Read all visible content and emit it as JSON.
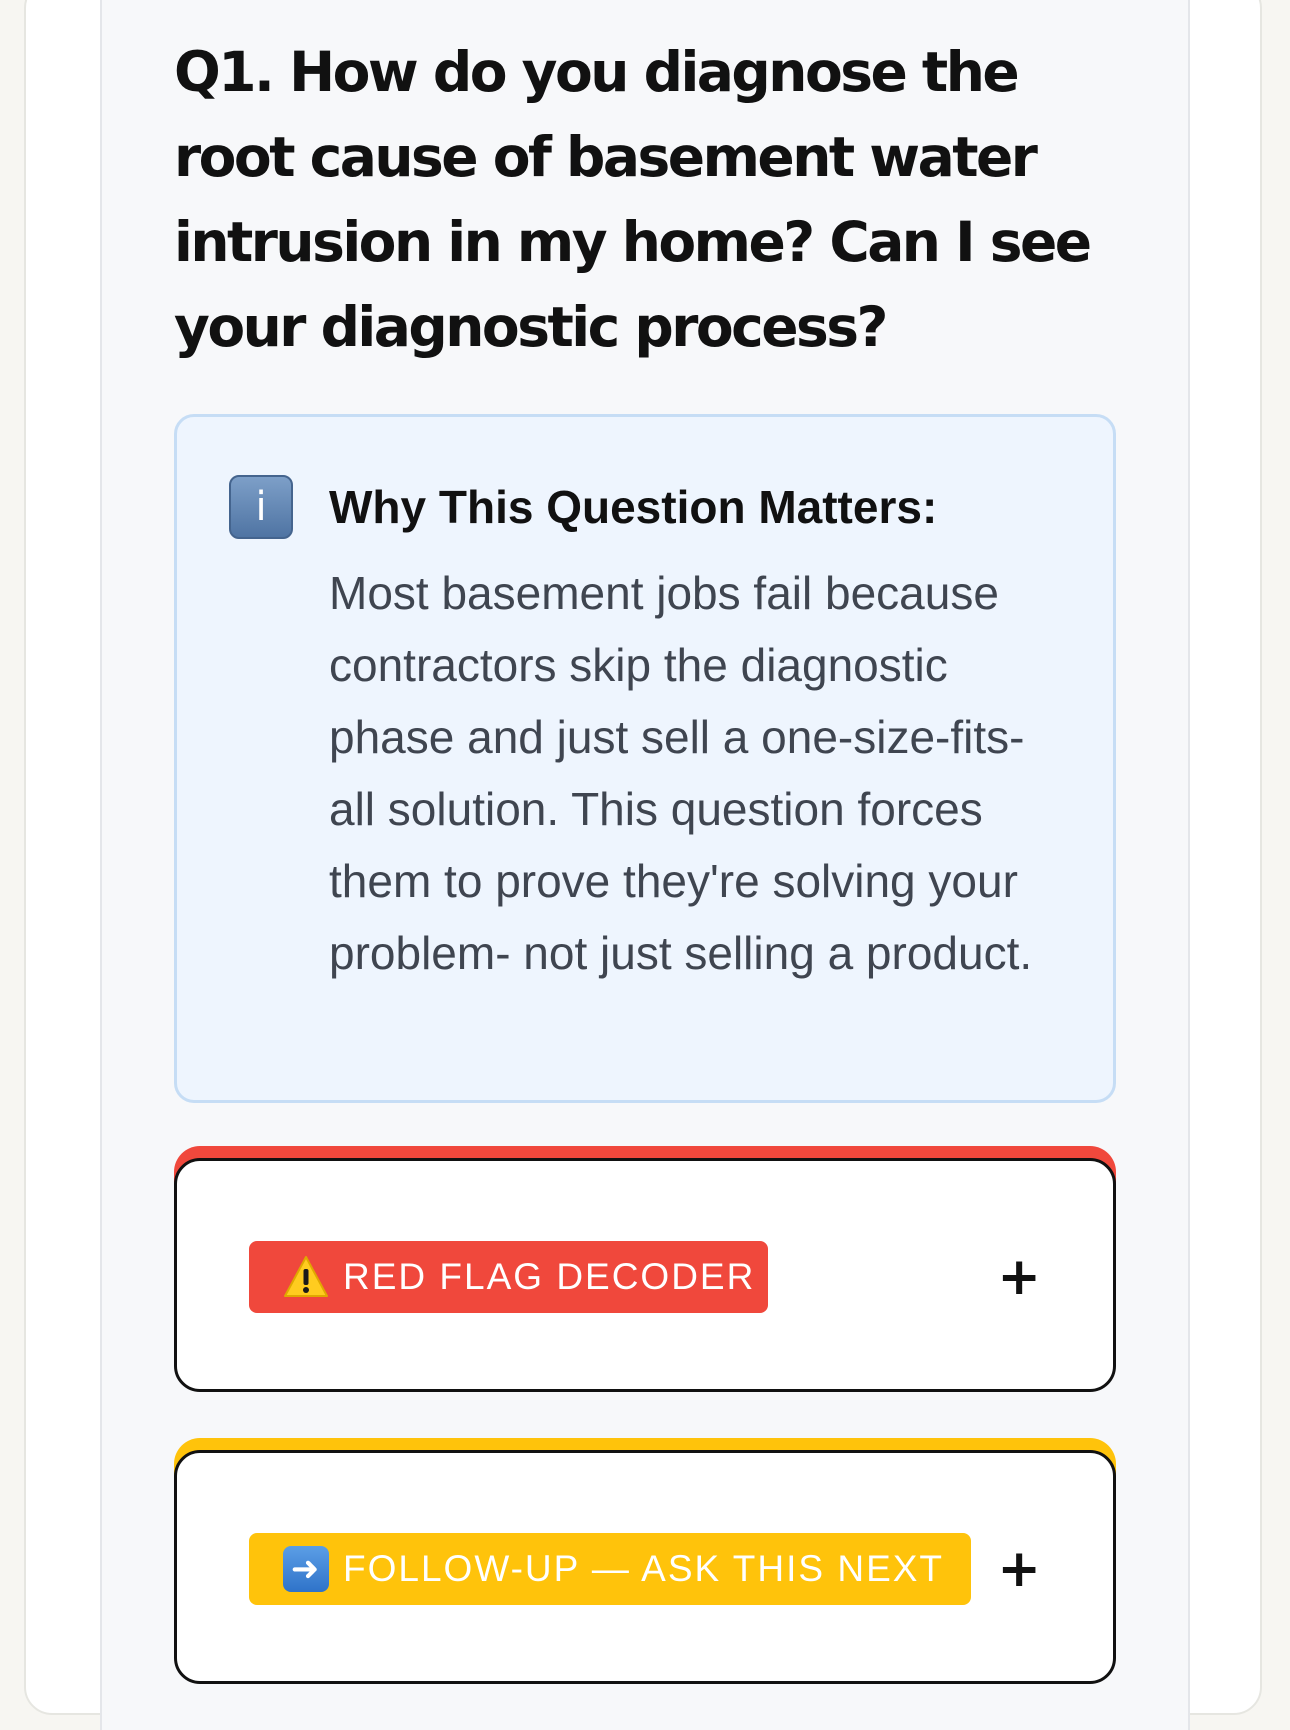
{
  "question": {
    "title": "Q1. How do you diagnose the root cause of basement water intrusion in my home? Can I see your diagnostic process?"
  },
  "info": {
    "icon": "info-icon",
    "glyph": "i",
    "title": "Why This Question Matters:",
    "body": "Most basement jobs fail because contractors skip the diagnostic phase and just sell a one-size-fits-all solution. This question forces them to prove they're solving your problem- not just selling a product."
  },
  "sections": [
    {
      "label": "RED FLAG DECODER",
      "icon": "warning-icon",
      "accent": "#f0483c",
      "toggle": "+"
    },
    {
      "label": "FOLLOW-UP — ASK THIS NEXT",
      "icon": "right-arrow-icon",
      "accent": "#ffc30b",
      "toggle": "+"
    }
  ]
}
